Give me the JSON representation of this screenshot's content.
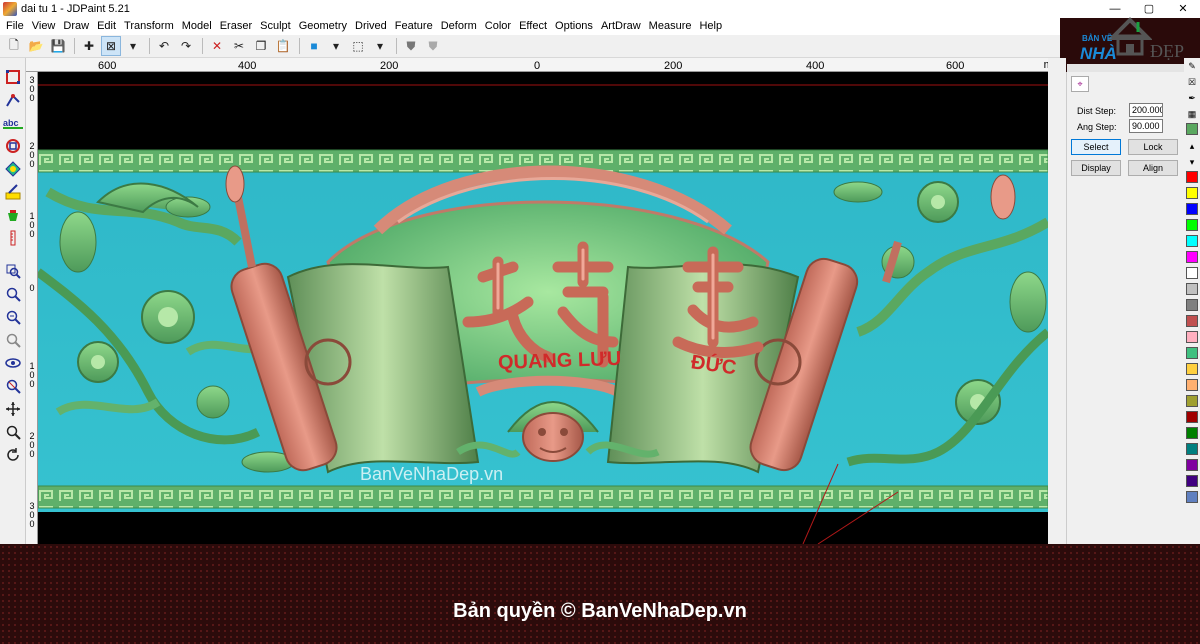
{
  "window": {
    "title": "dai tu 1 - JDPaint 5.21",
    "controls": [
      "—",
      "▢",
      "✕"
    ]
  },
  "menu": [
    "File",
    "View",
    "Draw",
    "Edit",
    "Transform",
    "Model",
    "Eraser",
    "Sculpt",
    "Geometry",
    "Drived",
    "Feature",
    "Deform",
    "Color",
    "Effect",
    "Options",
    "ArtDraw",
    "Measure",
    "Help"
  ],
  "logo": {
    "line1": "BẢN VẼ",
    "line2": "NHÀ",
    "line3": "ĐẸP"
  },
  "toolbar": [
    {
      "name": "new-file-icon",
      "glyph": "🗋"
    },
    {
      "name": "open-folder-icon",
      "glyph": "📂"
    },
    {
      "name": "save-icon",
      "glyph": "💾"
    },
    {
      "name": "crosshair-icon",
      "glyph": "✚"
    },
    {
      "name": "select-box-icon",
      "glyph": "⊠"
    },
    {
      "name": "dropdown-arrow-icon",
      "glyph": "▾"
    },
    {
      "name": "undo-icon",
      "glyph": "↶"
    },
    {
      "name": "redo-icon",
      "glyph": "↷"
    },
    {
      "name": "delete-icon",
      "glyph": "✕"
    },
    {
      "name": "cut-icon",
      "glyph": "✂"
    },
    {
      "name": "copy-icon",
      "glyph": "❐"
    },
    {
      "name": "paste-icon",
      "glyph": "📋"
    },
    {
      "name": "view-cube-icon",
      "glyph": "■"
    },
    {
      "name": "dropdown-arrow-icon",
      "glyph": "▾"
    },
    {
      "name": "view-box-icon",
      "glyph": "⬚"
    },
    {
      "name": "dropdown-arrow-icon",
      "glyph": "▾"
    },
    {
      "name": "shield-icon",
      "glyph": "⛊"
    },
    {
      "name": "shield-gray-icon",
      "glyph": "⛊"
    }
  ],
  "ruler": {
    "ticks": [
      "600",
      "400",
      "200",
      "0",
      "200",
      "400",
      "600"
    ],
    "unit": "mm",
    "vticks": [
      "300",
      "200",
      "100",
      "0",
      "100",
      "200",
      "300"
    ]
  },
  "props": {
    "dist_label": "Dist Step:",
    "dist_value": "200.000",
    "ang_label": "Ang Step:",
    "ang_value": "90.000",
    "select": "Select",
    "lock": "Lock",
    "display": "Display",
    "align": "Align"
  },
  "artwork": {
    "line1": "QUANG LƯU",
    "line2": "ĐỨC",
    "watermark": "BanVeNhaDep.vn"
  },
  "palette_colors": [
    "#ff0000",
    "#ffff00",
    "#0000ff",
    "#00ff00",
    "#00ffff",
    "#ff00ff",
    "#ffffff",
    "#c0c0c0",
    "#808080",
    "#c05050",
    "#ffb0c0",
    "#40c080",
    "#ffd040",
    "#ffb070",
    "#a0a030",
    "#a00000",
    "#008000",
    "#008080",
    "#8000a0",
    "#400080",
    "#6080c0"
  ],
  "footer": {
    "copyright": "Bản quyền © BanVeNhaDep.vn"
  }
}
